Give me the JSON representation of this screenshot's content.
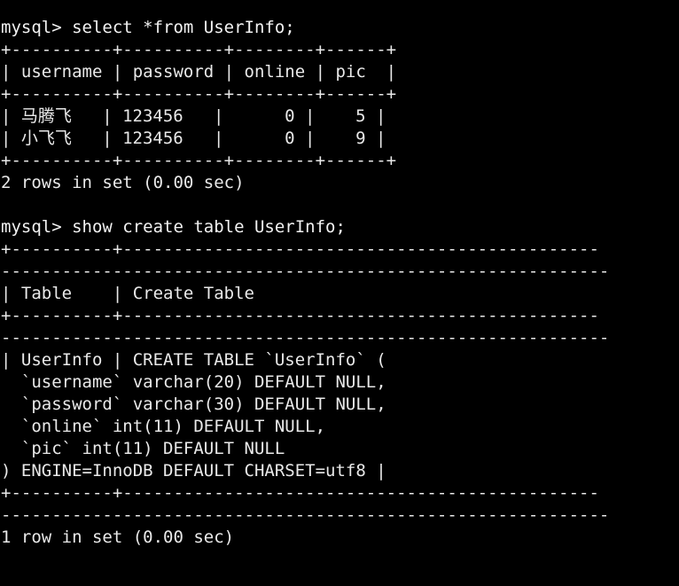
{
  "terminal": {
    "app": "mysql-client-terminal",
    "background_color": "#000000",
    "foreground_color": "#e9e9e9",
    "prompt": "mysql> ",
    "font_size_px": 19,
    "line_height_px": 25
  },
  "session": {
    "commands": [
      {
        "prompt": "mysql> ",
        "command": "select *from UserInfo;",
        "full_line": "mysql> select *from UserInfo;",
        "result_table": {
          "columns": [
            "username",
            "password",
            "online",
            "pic"
          ],
          "rows": [
            [
              "马腾飞",
              "123456",
              "0",
              "5"
            ],
            [
              "小飞飞",
              "123456",
              "0",
              "9"
            ]
          ],
          "border_top": "+----------+----------+--------+------+",
          "header_row": "| username | password | online | pic  |",
          "border_mid": "+----------+----------+--------+------+",
          "row_1": "| 马腾飞   | 123456   |      0 |    5 |",
          "row_2": "| 小飞飞   | 123456   |      0 |    9 |",
          "border_bottom": "+----------+----------+--------+------+"
        },
        "status": "2 rows in set (0.00 sec)",
        "row_count": 2,
        "elapsed": "0.00 sec"
      },
      {
        "prompt": "mysql> ",
        "command": "show create table UserInfo;",
        "full_line": "mysql> show create table UserInfo;",
        "result_table": {
          "columns": [
            "Table",
            "Create Table"
          ],
          "border_top_a": "+----------+-----------------------------------------------",
          "border_top_b": "------------------------------------------------------------",
          "header_row": "| Table    | Create Table",
          "border_mid_a": "+----------+-----------------------------------------------",
          "border_mid_b": "------------------------------------------------------------",
          "body_lines": [
            "| UserInfo | CREATE TABLE `UserInfo` (",
            "  `username` varchar(20) DEFAULT NULL,",
            "  `password` varchar(30) DEFAULT NULL,",
            "  `online` int(11) DEFAULT NULL,",
            "  `pic` int(11) DEFAULT NULL",
            ") ENGINE=InnoDB DEFAULT CHARSET=utf8 |"
          ],
          "border_bottom_a": "+----------+-----------------------------------------------",
          "border_bottom_b": "------------------------------------------------------------"
        },
        "status": "1 row in set (0.00 sec)",
        "row_count": 1,
        "elapsed": "0.00 sec"
      }
    ],
    "blank": ""
  },
  "ddl": {
    "table_name": "UserInfo",
    "engine": "InnoDB",
    "charset": "utf8",
    "columns": [
      {
        "name": "username",
        "type": "varchar(20)",
        "default": "DEFAULT NULL"
      },
      {
        "name": "password",
        "type": "varchar(30)",
        "default": "DEFAULT NULL"
      },
      {
        "name": "online",
        "type": "int(11)",
        "default": "DEFAULT NULL"
      },
      {
        "name": "pic",
        "type": "int(11)",
        "default": "DEFAULT NULL"
      }
    ]
  }
}
